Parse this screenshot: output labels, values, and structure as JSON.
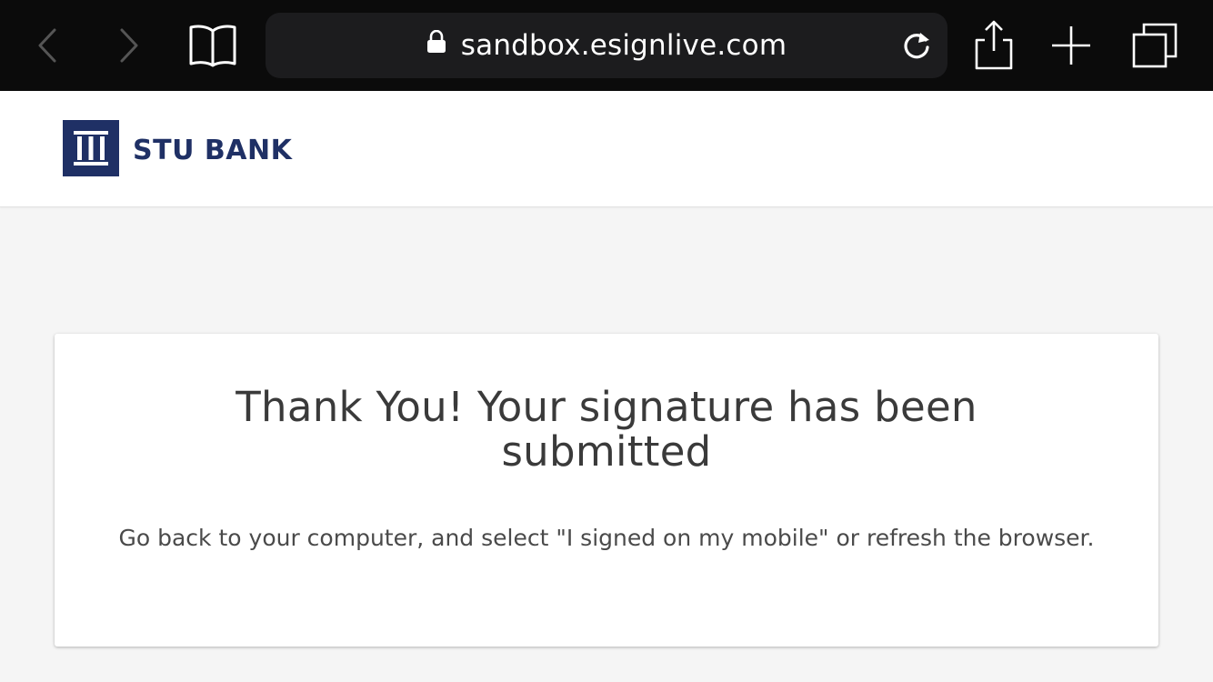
{
  "browser": {
    "url": "sandbox.esignlive.com",
    "icons": {
      "back": "chevron-left-icon",
      "forward": "chevron-right-icon",
      "bookmarks": "book-icon",
      "lock": "lock-icon",
      "reload": "reload-icon",
      "share": "share-icon",
      "new_tab": "plus-icon",
      "tabs": "tabs-icon"
    },
    "colors": {
      "toolbar_bg": "#0b0b0b",
      "urlbar_bg": "#1c1c1e",
      "icon_active": "#ffffff",
      "icon_disabled": "#555555"
    }
  },
  "header": {
    "brand_name": "STU BANK",
    "brand_color": "#1f3065"
  },
  "confirmation": {
    "title": "Thank You! Your signature has been submitted",
    "message": "Go back to your computer, and select \"I signed on my mobile\" or refresh the browser."
  }
}
